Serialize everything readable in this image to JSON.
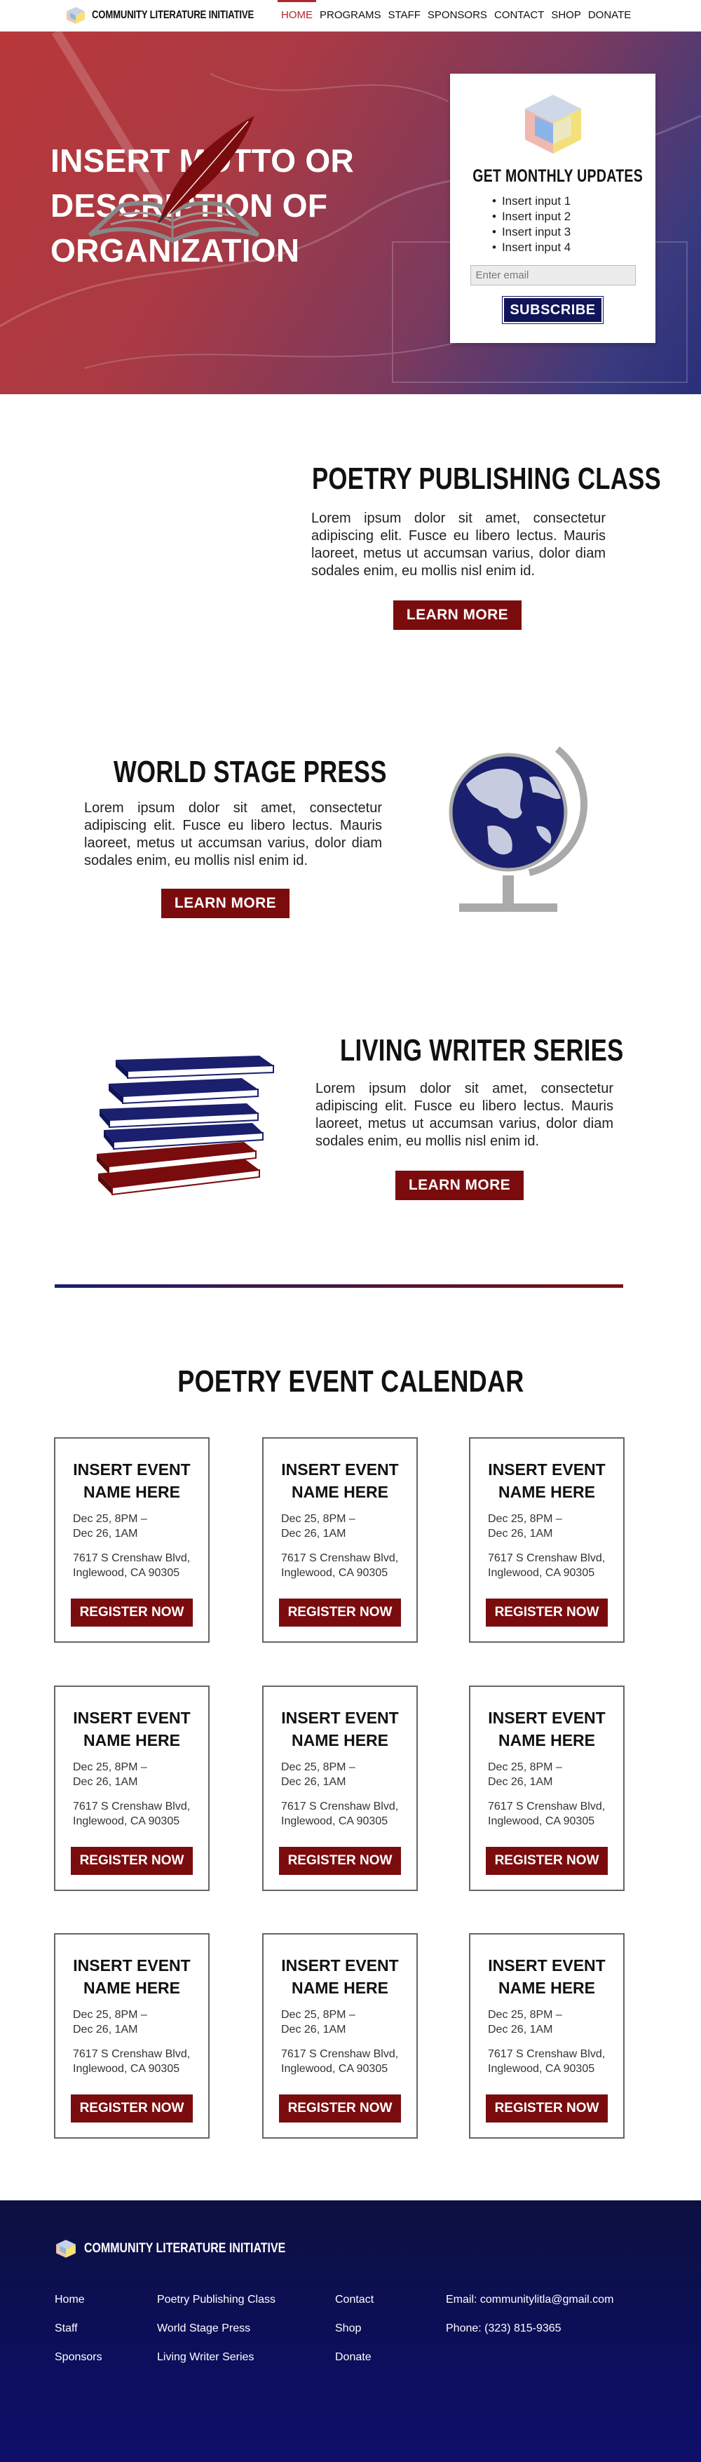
{
  "colors": {
    "accent_red": "#7b0c0e",
    "nav_active": "#b0262c",
    "navy": "#10155a",
    "footer_bg": "#0c0f55"
  },
  "brand": {
    "name": "COMMUNITY LITERATURE INITIATIVE",
    "logo_icon": "cube-logo-icon"
  },
  "nav": {
    "items": [
      {
        "label": "HOME",
        "active": true
      },
      {
        "label": "PROGRAMS"
      },
      {
        "label": "STAFF"
      },
      {
        "label": "SPONSORS"
      },
      {
        "label": "CONTACT"
      },
      {
        "label": "SHOP"
      },
      {
        "label": "DONATE"
      }
    ]
  },
  "hero": {
    "motto_lines": [
      "INSERT MOTTO OR",
      "DESCRIPTION OF",
      "ORGANIZATION"
    ],
    "signup": {
      "title": "GET MONTHLY UPDATES",
      "bullets": [
        "Insert input 1",
        "Insert input 2",
        "Insert input 3",
        "Insert input 4"
      ],
      "email_placeholder": "Enter email",
      "button": "SUBSCRIBE"
    }
  },
  "features": [
    {
      "title": "POETRY PUBLISHING CLASS",
      "body": "Lorem ipsum dolor sit amet, consectetur adipiscing elit. Fusce eu libero lectus. Mauris laoreet, metus ut accumsan varius, dolor diam sodales enim, eu mollis nisl enim id.",
      "button": "LEARN MORE",
      "icon": "quill-book-icon"
    },
    {
      "title": "WORLD STAGE PRESS",
      "body": "Lorem ipsum dolor sit amet, consectetur adipiscing elit. Fusce eu libero lectus. Mauris laoreet, metus ut accumsan varius, dolor diam sodales enim, eu mollis nisl enim id.",
      "button": "LEARN MORE",
      "icon": "globe-icon"
    },
    {
      "title": "LIVING WRITER SERIES",
      "body": "Lorem ipsum dolor sit amet, consectetur adipiscing elit. Fusce eu libero lectus. Mauris laoreet, metus ut accumsan varius, dolor diam sodales enim, eu mollis nisl enim id.",
      "button": "LEARN MORE",
      "icon": "book-stack-icon"
    }
  ],
  "calendar": {
    "title": "POETRY EVENT CALENDAR",
    "event_template": {
      "name": "INSERT EVENT NAME HERE",
      "date_line1": "Dec 25, 8PM  –",
      "date_line2": "Dec 26, 1AM",
      "addr_line1": "7617 S Crenshaw Blvd,",
      "addr_line2": "Inglewood, CA 90305",
      "button": "REGISTER NOW"
    },
    "event_count": 9
  },
  "footer": {
    "brand": "COMMUNITY LITERATURE INITIATIVE",
    "col1": [
      "Home",
      "Staff",
      "Sponsors"
    ],
    "col2": [
      "Poetry Publishing Class",
      "World Stage Press",
      "Living Writer Series"
    ],
    "col3": [
      "Contact",
      "Shop",
      "Donate"
    ],
    "email": "Email: communitylitla@gmail.com",
    "phone": "Phone: (323) 815-9365"
  }
}
